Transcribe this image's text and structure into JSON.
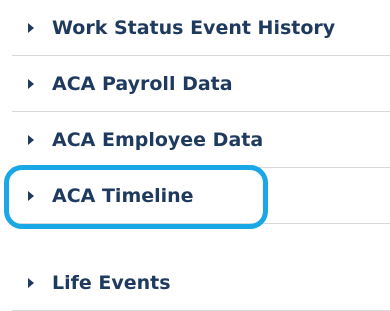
{
  "menu": {
    "items": [
      {
        "label": "Work Status Event History"
      },
      {
        "label": "ACA Payroll Data"
      },
      {
        "label": "ACA Employee Data"
      },
      {
        "label": "ACA Timeline"
      },
      {
        "label": "Life Events"
      }
    ]
  },
  "colors": {
    "text": "#1f3a5f",
    "divider": "#d9d9d9",
    "highlight": "#1aa7e6"
  },
  "icons": {
    "expand": "caret-right-icon"
  },
  "annotation": {
    "highlighted_item": "ACA Timeline"
  }
}
